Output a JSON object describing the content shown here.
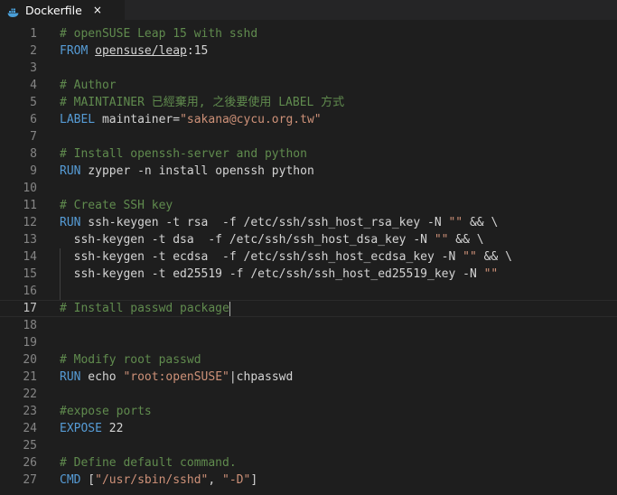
{
  "tab": {
    "label": "Dockerfile",
    "close": "×",
    "icon": "docker-icon"
  },
  "colors": {
    "background": "#1e1e1e",
    "comment": "#608b4e",
    "keyword": "#569cd6",
    "string": "#ce9178",
    "text": "#d4d4d4",
    "line_number": "#858585"
  },
  "editor": {
    "current_line": 17,
    "lines": [
      {
        "n": "1",
        "tokens": [
          {
            "c": "comment",
            "t": "# openSUSE Leap 15 with sshd"
          }
        ]
      },
      {
        "n": "2",
        "tokens": [
          {
            "c": "kw",
            "t": "FROM"
          },
          {
            "c": "plain",
            "t": " "
          },
          {
            "c": "link",
            "t": "opensuse/leap"
          },
          {
            "c": "plain",
            "t": ":15"
          }
        ]
      },
      {
        "n": "3",
        "tokens": []
      },
      {
        "n": "4",
        "tokens": [
          {
            "c": "comment",
            "t": "# Author"
          }
        ]
      },
      {
        "n": "5",
        "tokens": [
          {
            "c": "comment",
            "t": "# MAINTAINER 已經棄用, 之後要使用 LABEL 方式"
          }
        ]
      },
      {
        "n": "6",
        "tokens": [
          {
            "c": "kw",
            "t": "LABEL"
          },
          {
            "c": "plain",
            "t": " maintainer="
          },
          {
            "c": "str",
            "t": "\"sakana@cycu.org.tw\""
          }
        ]
      },
      {
        "n": "7",
        "tokens": []
      },
      {
        "n": "8",
        "tokens": [
          {
            "c": "comment",
            "t": "# Install openssh-server and python"
          }
        ]
      },
      {
        "n": "9",
        "tokens": [
          {
            "c": "kw",
            "t": "RUN"
          },
          {
            "c": "plain",
            "t": " zypper -n install openssh python"
          }
        ]
      },
      {
        "n": "10",
        "tokens": []
      },
      {
        "n": "11",
        "tokens": [
          {
            "c": "comment",
            "t": "# Create SSH key"
          }
        ]
      },
      {
        "n": "12",
        "tokens": [
          {
            "c": "kw",
            "t": "RUN"
          },
          {
            "c": "plain",
            "t": " ssh-keygen -t rsa  -f /etc/ssh/ssh_host_rsa_key -N "
          },
          {
            "c": "str",
            "t": "\"\""
          },
          {
            "c": "plain",
            "t": " && \\"
          }
        ]
      },
      {
        "n": "13",
        "tokens": [
          {
            "c": "plain",
            "t": "  ssh-keygen -t dsa  -f /etc/ssh/ssh_host_dsa_key -N "
          },
          {
            "c": "str",
            "t": "\"\""
          },
          {
            "c": "plain",
            "t": " && \\"
          }
        ]
      },
      {
        "n": "14",
        "tokens": [
          {
            "c": "plain",
            "t": "  ssh-keygen -t ecdsa  -f /etc/ssh/ssh_host_ecdsa_key -N "
          },
          {
            "c": "str",
            "t": "\"\""
          },
          {
            "c": "plain",
            "t": " && \\"
          }
        ]
      },
      {
        "n": "15",
        "tokens": [
          {
            "c": "plain",
            "t": "  ssh-keygen -t ed25519 -f /etc/ssh/ssh_host_ed25519_key -N "
          },
          {
            "c": "str",
            "t": "\"\""
          }
        ]
      },
      {
        "n": "16",
        "tokens": []
      },
      {
        "n": "17",
        "tokens": [
          {
            "c": "comment",
            "t": "# Install passwd package"
          }
        ]
      },
      {
        "n": "18",
        "tokens": []
      },
      {
        "n": "19",
        "tokens": []
      },
      {
        "n": "20",
        "tokens": [
          {
            "c": "comment",
            "t": "# Modify root passwd"
          }
        ]
      },
      {
        "n": "21",
        "tokens": [
          {
            "c": "kw",
            "t": "RUN"
          },
          {
            "c": "plain",
            "t": " echo "
          },
          {
            "c": "str",
            "t": "\"root:openSUSE\""
          },
          {
            "c": "plain",
            "t": "|chpasswd"
          }
        ]
      },
      {
        "n": "22",
        "tokens": []
      },
      {
        "n": "23",
        "tokens": [
          {
            "c": "comment",
            "t": "#expose ports"
          }
        ]
      },
      {
        "n": "24",
        "tokens": [
          {
            "c": "kw",
            "t": "EXPOSE"
          },
          {
            "c": "plain",
            "t": " 22"
          }
        ]
      },
      {
        "n": "25",
        "tokens": []
      },
      {
        "n": "26",
        "tokens": [
          {
            "c": "comment",
            "t": "# Define default command."
          }
        ]
      },
      {
        "n": "27",
        "tokens": [
          {
            "c": "kw",
            "t": "CMD"
          },
          {
            "c": "plain",
            "t": " ["
          },
          {
            "c": "str",
            "t": "\"/usr/sbin/sshd\""
          },
          {
            "c": "plain",
            "t": ", "
          },
          {
            "c": "str",
            "t": "\"-D\""
          },
          {
            "c": "plain",
            "t": "]"
          }
        ]
      }
    ]
  }
}
